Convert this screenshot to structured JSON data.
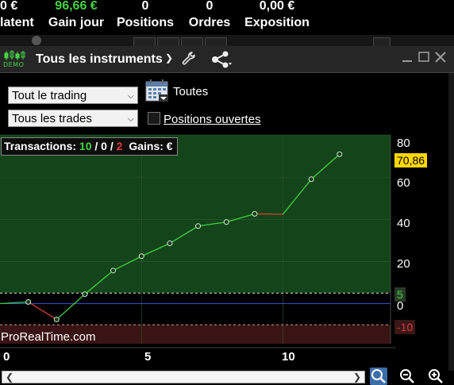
{
  "summary": [
    {
      "value": "0 €",
      "label": "latent"
    },
    {
      "value": "96,66 €",
      "label": "Gain jour"
    },
    {
      "value": "0",
      "label": "Positions"
    },
    {
      "value": "0",
      "label": "Ordres"
    },
    {
      "value": "0,00 €",
      "label": "Exposition"
    }
  ],
  "window": {
    "demo_label": "DEMO",
    "title": "Tous les instruments"
  },
  "filters": {
    "trading_select": "Tout le trading",
    "trades_select": "Tous les trades",
    "period_label": "Toutes",
    "open_positions_label": "Positions ouvertes",
    "open_positions_checked": false
  },
  "stats": {
    "transactions_label": "Transactions:",
    "wins": "10",
    "neutral": "0",
    "losses": "2",
    "sep": "/",
    "gains_label": "Gains: €"
  },
  "watermark": "ProRealTime.com",
  "colors": {
    "profit_zone": "#14441a",
    "loss_zone": "#3a1414",
    "up_line": "#3fd23f",
    "down_line": "#e03a3a",
    "current_badge": "#ffd700",
    "loss_badge": "#3a1818"
  },
  "chart_data": {
    "type": "line",
    "x": [
      0,
      1,
      2,
      3,
      4,
      5,
      6,
      7,
      8,
      9,
      10,
      11,
      12
    ],
    "values": [
      0,
      0.8,
      -7.5,
      4.5,
      15.7,
      22.5,
      28.6,
      36.8,
      38.7,
      42.6,
      42.4,
      59,
      70.86
    ],
    "current_value": "70,86",
    "upper_marker": "5",
    "lower_marker": "-10",
    "x_ticks": [
      "0",
      "5",
      "10"
    ],
    "y_ticks": [
      "80",
      "60",
      "40",
      "20",
      "0"
    ],
    "xlim": [
      0,
      13.8
    ],
    "ylim": [
      -19,
      80
    ]
  }
}
